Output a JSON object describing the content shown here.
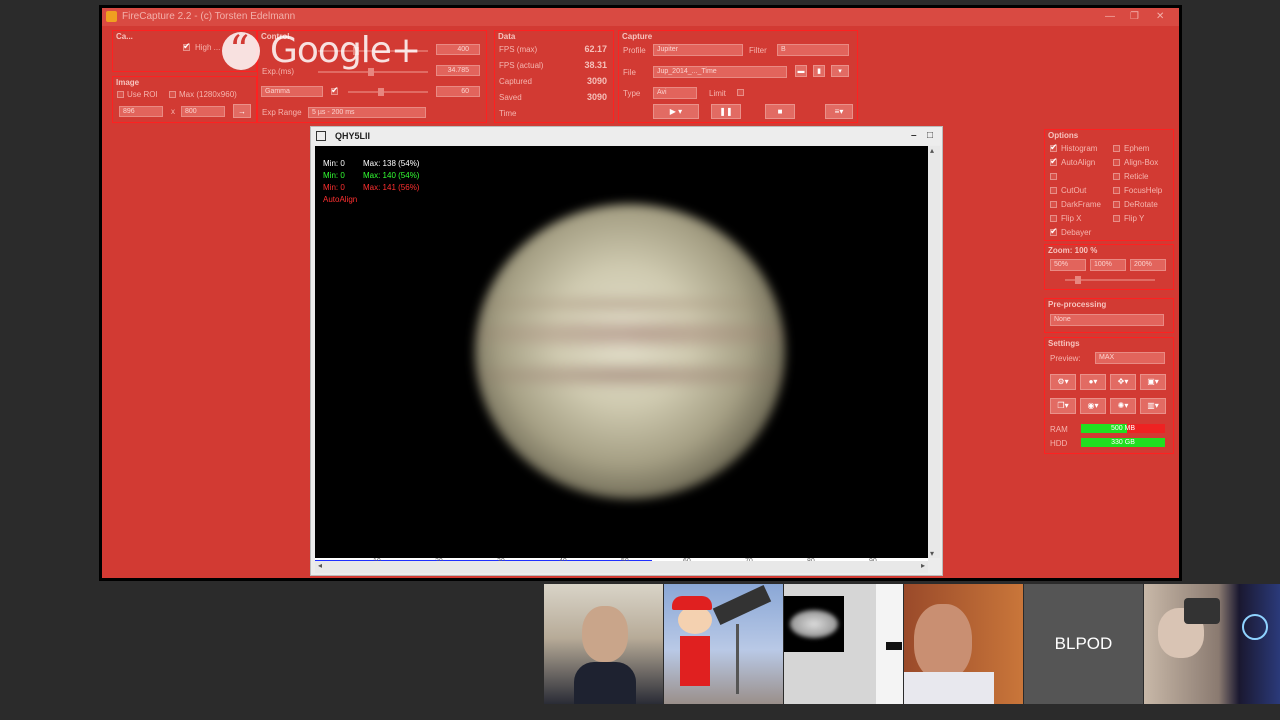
{
  "window": {
    "title": "FireCapture 2.2 - (c) Torsten Edelmann"
  },
  "overlay": {
    "logo_text": "Google+"
  },
  "camera_panel": {
    "title": "Ca...",
    "checkbox_label": "High ...",
    "roi_title": "Image",
    "use_roi": "Use ROI",
    "max_roi": "Max (1280x960)",
    "width": "896",
    "height": "800"
  },
  "control_panel": {
    "title": "Control",
    "exposure_value": "400",
    "exposure_ms_label": "Exp.(ms)",
    "gain_value": "34.785",
    "gamma_select": "Gamma",
    "gamma_value": "60",
    "exp_range_label": "Exp Range",
    "exp_range_select": "5 µs - 200 ms"
  },
  "data_panel": {
    "title": "Data",
    "rows": [
      {
        "label": "FPS (max)",
        "value": "62.17"
      },
      {
        "label": "FPS (actual)",
        "value": "38.31"
      },
      {
        "label": "Captured",
        "value": "3090"
      },
      {
        "label": "Saved",
        "value": "3090"
      },
      {
        "label": "Time",
        "value": ""
      }
    ]
  },
  "capture_panel": {
    "title": "Capture",
    "profile_label": "Profile",
    "profile_value": "Jupiter",
    "filter_label": "Filter",
    "filter_value": "B",
    "file_label": "File",
    "file_value": "Jup_2014_..._Time",
    "type_label": "Type",
    "type_value": "Avi",
    "limit_label": "Limit"
  },
  "camera_window": {
    "title": "QHY5LII",
    "stats": [
      {
        "min": "Min: 0",
        "max": "Max: 138 (54%)",
        "color": "#ffffff"
      },
      {
        "min": "Min: 0",
        "max": "Max: 140 (54%)",
        "color": "#33ff33"
      },
      {
        "min": "Min: 0",
        "max": "Max: 141 (56%)",
        "color": "#ff3030"
      }
    ],
    "autoalign": "AutoAlign",
    "histogram_ticks": [
      "10",
      "20",
      "30",
      "40",
      "50",
      "60",
      "70",
      "80",
      "90"
    ],
    "histogram_fill": 0.55
  },
  "options_panel": {
    "title": "Options",
    "left": [
      {
        "label": "Histogram",
        "checked": true
      },
      {
        "label": "AutoAlign",
        "checked": true
      },
      {
        "label": "",
        "checked": false
      },
      {
        "label": "CutOut",
        "checked": false
      },
      {
        "label": "DarkFrame",
        "checked": false
      },
      {
        "label": "Flip X",
        "checked": false
      },
      {
        "label": "Debayer",
        "checked": true
      }
    ],
    "right": [
      {
        "label": "Ephem",
        "checked": false
      },
      {
        "label": "Align-Box",
        "checked": false
      },
      {
        "label": "Reticle",
        "checked": false
      },
      {
        "label": "FocusHelp",
        "checked": false
      },
      {
        "label": "DeRotate",
        "checked": false
      },
      {
        "label": "Flip Y",
        "checked": false
      }
    ]
  },
  "zoom_panel": {
    "title": "Zoom: 100 %",
    "buttons": [
      "50%",
      "100%",
      "200%"
    ]
  },
  "preprocessing_panel": {
    "title": "Pre-processing",
    "select": "None"
  },
  "settings_panel": {
    "title": "Settings",
    "preview_label": "Preview:",
    "preview_value": "MAX",
    "ram_label": "RAM",
    "ram_value": "500 MB",
    "hdd_label": "HDD",
    "hdd_value": "330 GB"
  },
  "participants": [
    {
      "name": ""
    },
    {
      "name": ""
    },
    {
      "name": ""
    },
    {
      "name": ""
    },
    {
      "name": "BLPOD"
    },
    {
      "name": ""
    }
  ],
  "colors": {
    "accent": "#d23a33",
    "panel_border": "#ff2020",
    "ram_bar": "#20e020",
    "hdd_bar": "#20e020"
  }
}
